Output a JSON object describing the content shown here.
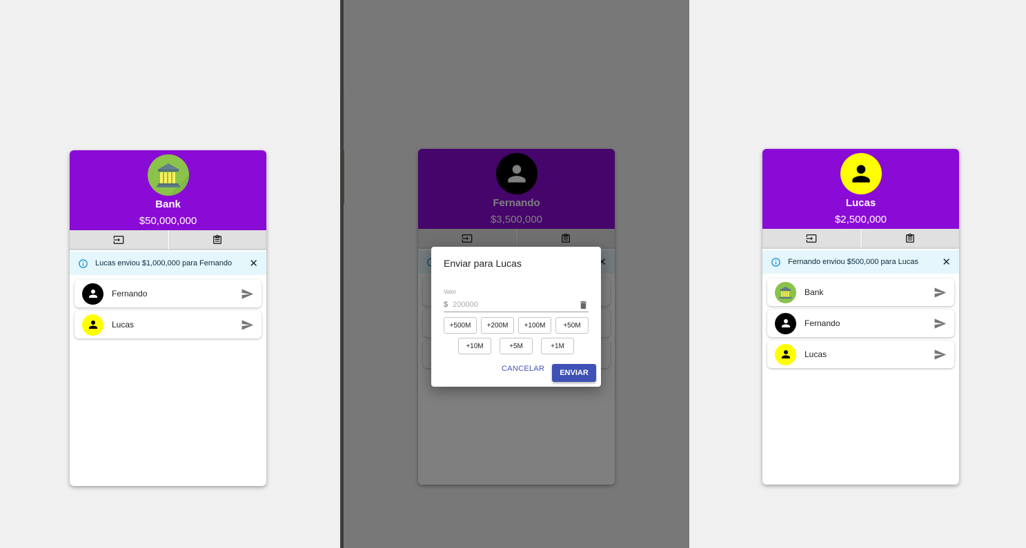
{
  "panels": [
    {
      "id": "bank",
      "name": "Bank",
      "balance": "$50,000,000",
      "avatar": "bank-icon",
      "notification": "Lucas enviou $1,000,000 para Fernando",
      "contacts": [
        {
          "name": "Fernando",
          "avatar": "person-icon",
          "avatar_color": "#000000"
        },
        {
          "name": "Lucas",
          "avatar": "person-icon",
          "avatar_color": "#ffff00"
        }
      ]
    },
    {
      "id": "fernando",
      "name": "Fernando",
      "balance": "$3,500,000",
      "avatar": "person-icon"
    },
    {
      "id": "lucas",
      "name": "Lucas",
      "balance": "$2,500,000",
      "avatar": "person-icon",
      "notification": "Fernando enviou $500,000 para Lucas",
      "contacts": [
        {
          "name": "Bank",
          "avatar": "bank-icon"
        },
        {
          "name": "Fernando",
          "avatar": "person-icon",
          "avatar_color": "#000000"
        },
        {
          "name": "Lucas",
          "avatar": "person-icon",
          "avatar_color": "#ffff00"
        }
      ]
    }
  ],
  "dialog": {
    "title": "Enviar para Lucas",
    "field_label": "Valor",
    "currency_prefix": "$",
    "amount_placeholder": "200000",
    "quick_amounts": [
      "+500M",
      "+200M",
      "+100M",
      "+50M",
      "+10M",
      "+5M",
      "+1M"
    ],
    "cancel_label": "CANCELAR",
    "send_label": "ENVIAR"
  },
  "colors": {
    "header": "#8b0bd6",
    "primary": "#3f51b5",
    "alert_bg": "#e5f6fd",
    "info": "#0288d1"
  }
}
